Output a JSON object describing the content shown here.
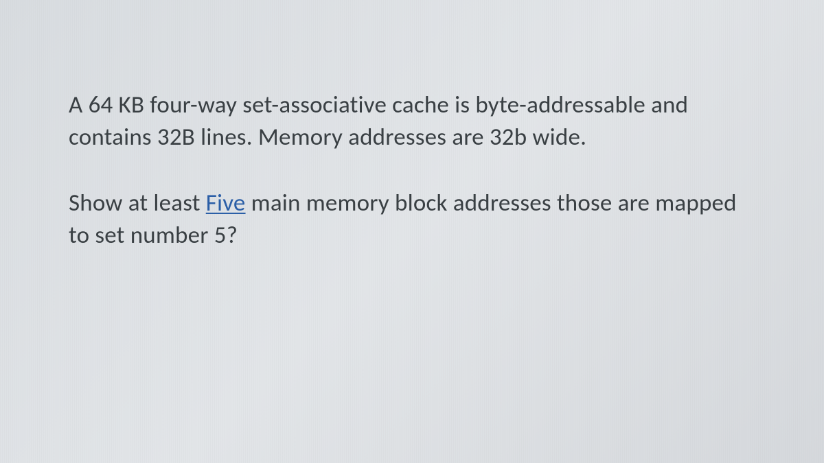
{
  "document": {
    "paragraph1_part1": "A 64 KB four-way set-associative cache is byte-addressable and contains 32B lines. Memory addresses are 32b wide.",
    "paragraph2_prefix": "Show at least ",
    "paragraph2_underlined": "Five",
    "paragraph2_suffix": " main memory block addresses those are mapped to set number 5?"
  }
}
